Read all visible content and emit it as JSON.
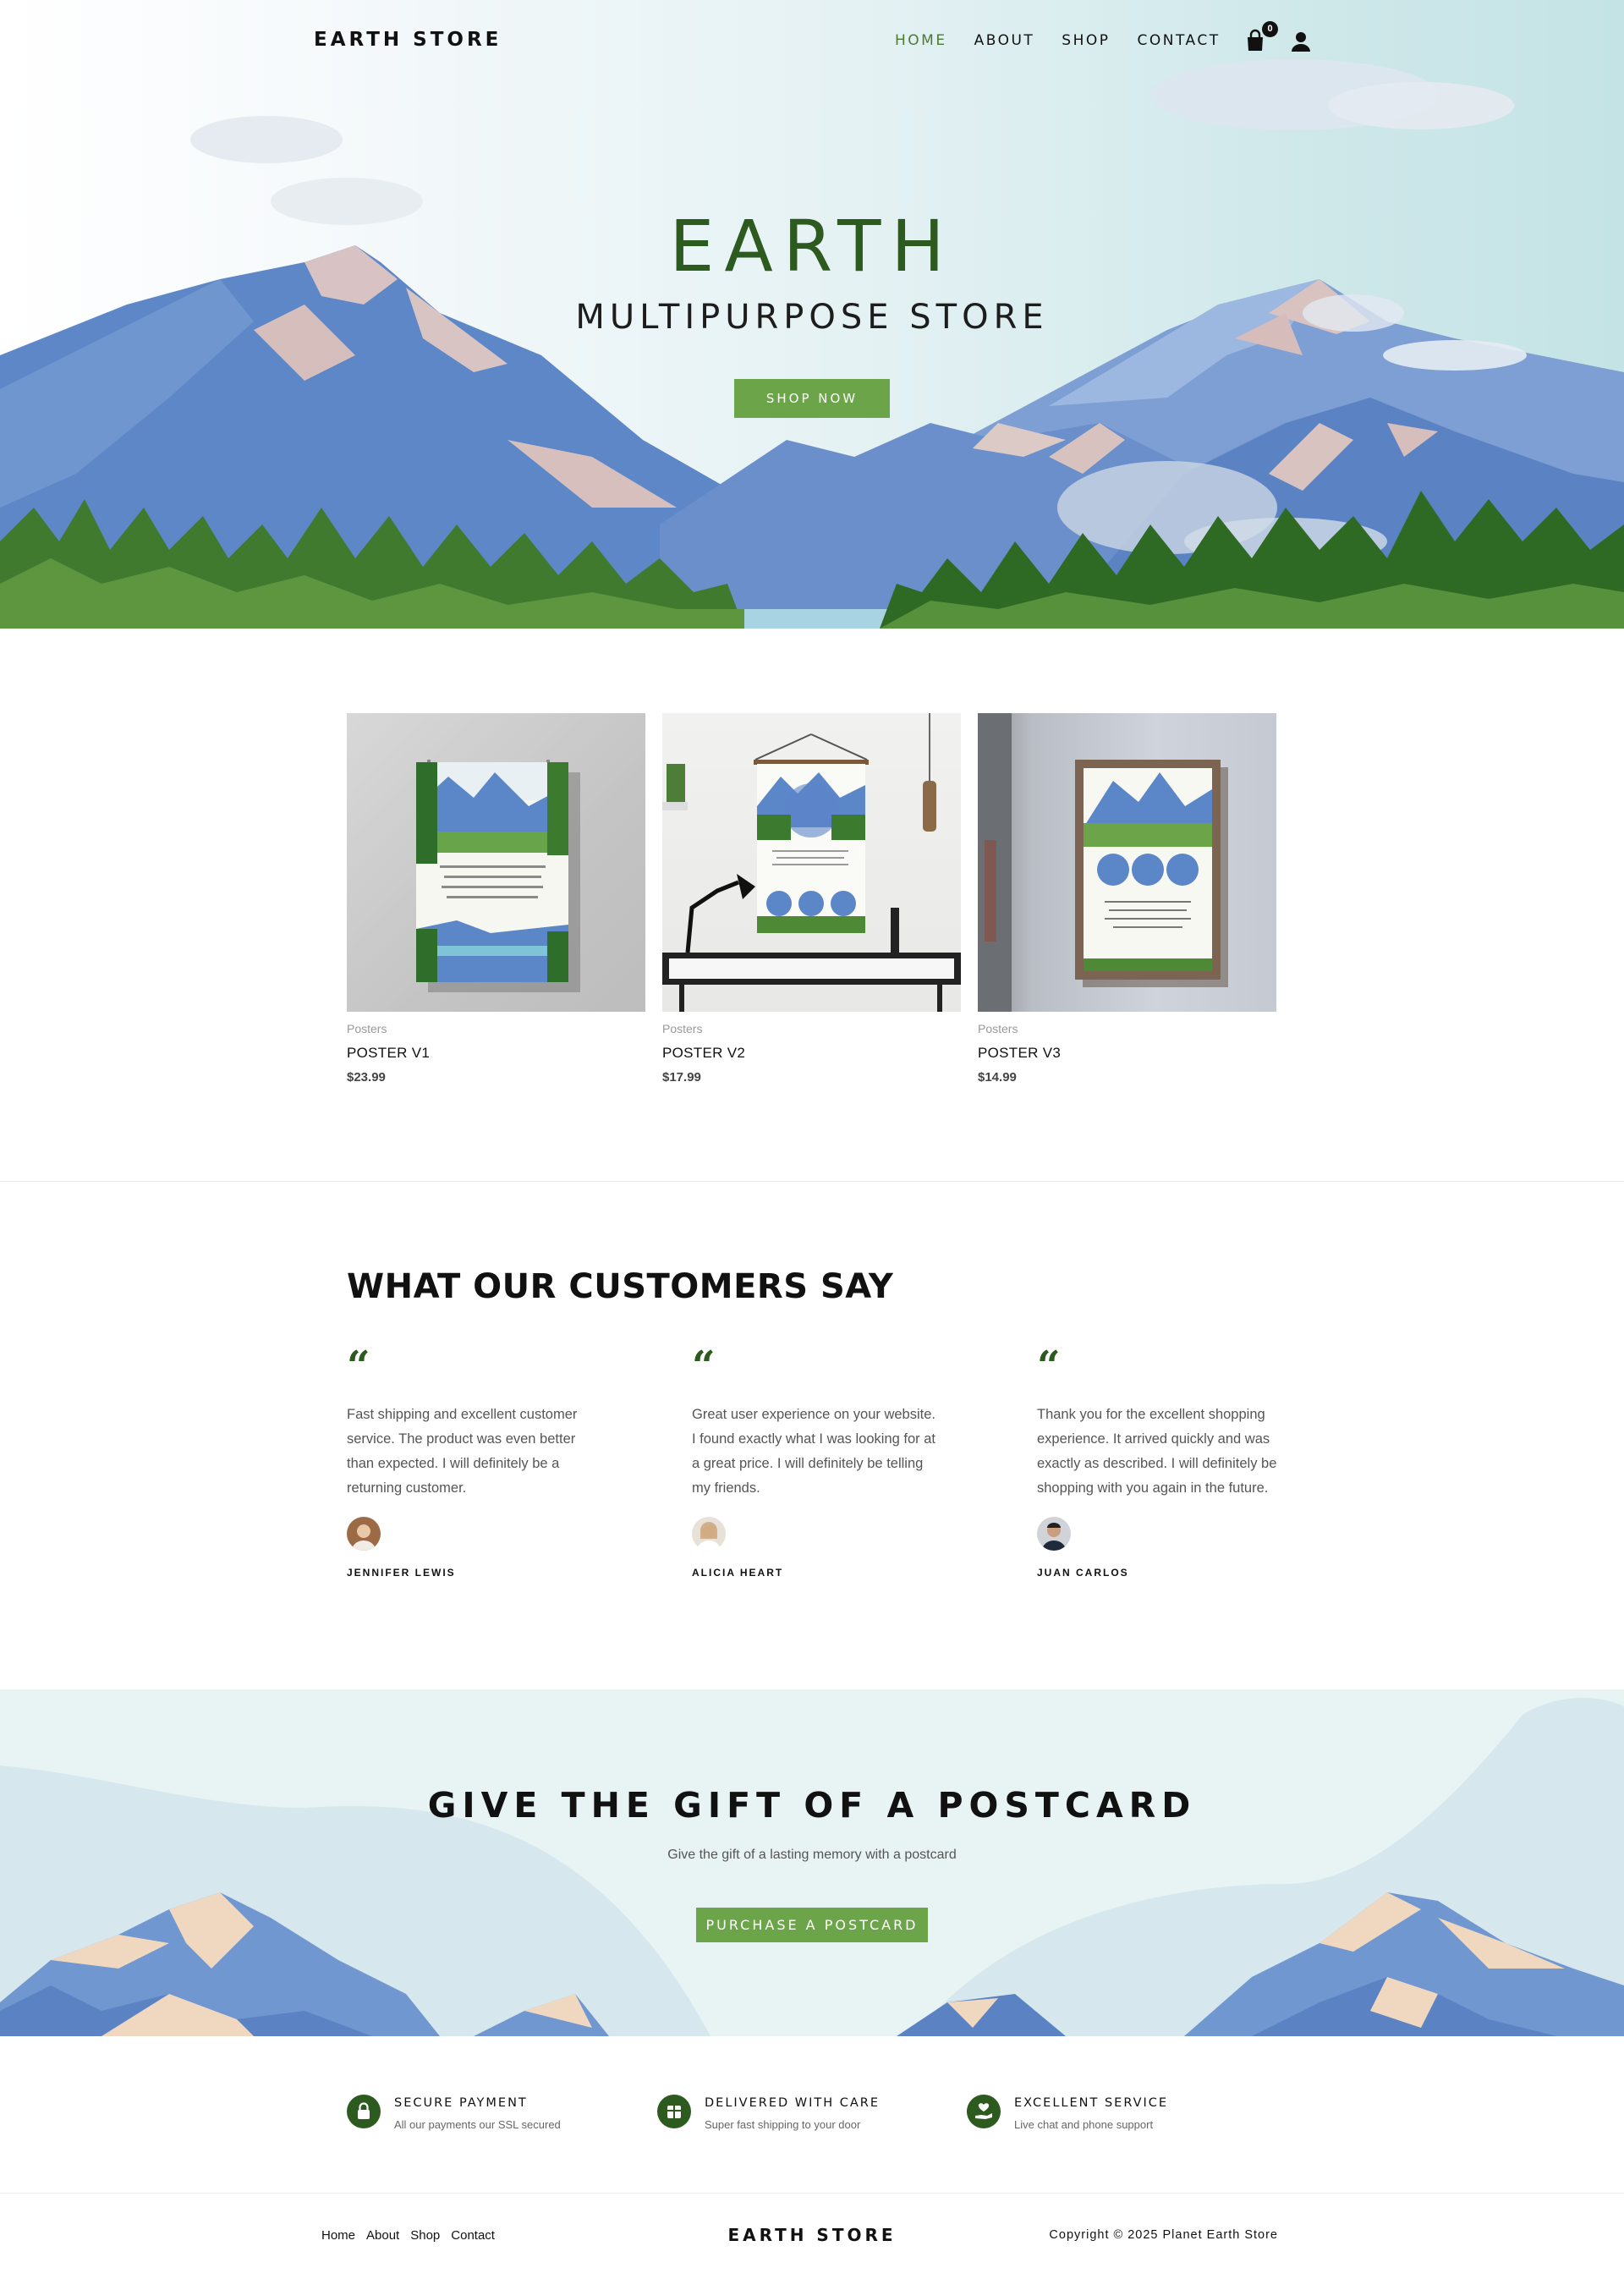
{
  "header": {
    "logo": "EARTH STORE",
    "nav": [
      "HOME",
      "ABOUT",
      "SHOP",
      "CONTACT"
    ],
    "active_nav": "HOME",
    "cart_count": "0",
    "icons": [
      "shopping-bag-icon",
      "user-icon"
    ]
  },
  "hero": {
    "title": "EARTH",
    "subtitle": "MULTIPURPOSE STORE",
    "cta": "SHOP NOW"
  },
  "products": [
    {
      "category": "Posters",
      "name": "POSTER V1",
      "price": "$23.99"
    },
    {
      "category": "Posters",
      "name": "POSTER V2",
      "price": "$17.99"
    },
    {
      "category": "Posters",
      "name": "POSTER V3",
      "price": "$14.99"
    }
  ],
  "testimonials": {
    "title": "WHAT OUR CUSTOMERS SAY",
    "items": [
      {
        "text": "Fast shipping and excellent customer service. The product was even better than expected. I will definitely be a returning customer.",
        "name": "JENNIFER LEWIS"
      },
      {
        "text": "Great user experience on your website. I found exactly what I was looking for at a great price. I will definitely be telling my friends.",
        "name": "ALICIA HEART"
      },
      {
        "text": "Thank you for the excellent shopping experience. It arrived quickly and was exactly as described. I will definitely be shopping with you again in the future.",
        "name": "JUAN CARLOS"
      }
    ]
  },
  "postcard": {
    "title": "GIVE THE GIFT OF A POSTCARD",
    "subtitle": "Give the gift of a lasting memory with a postcard",
    "cta": "PURCHASE A POSTCARD"
  },
  "features": [
    {
      "title": "SECURE PAYMENT",
      "text": "All our payments our SSL secured",
      "icon": "lock-icon"
    },
    {
      "title": "DELIVERED WITH CARE",
      "text": "Super fast shipping to your door",
      "icon": "package-icon"
    },
    {
      "title": "EXCELLENT SERVICE",
      "text": "Live chat and phone support",
      "icon": "hand-heart-icon"
    }
  ],
  "footer": {
    "links": [
      "Home",
      "About",
      "Shop",
      "Contact"
    ],
    "logo": "EARTH STORE",
    "copyright": "Copyright © 2025 Planet Earth Store"
  },
  "colors": {
    "accent_green": "#6ca44a",
    "dark_green": "#2c5a1f",
    "mountain_blue": "#5b83c4",
    "sky": "#cfe8ea"
  }
}
